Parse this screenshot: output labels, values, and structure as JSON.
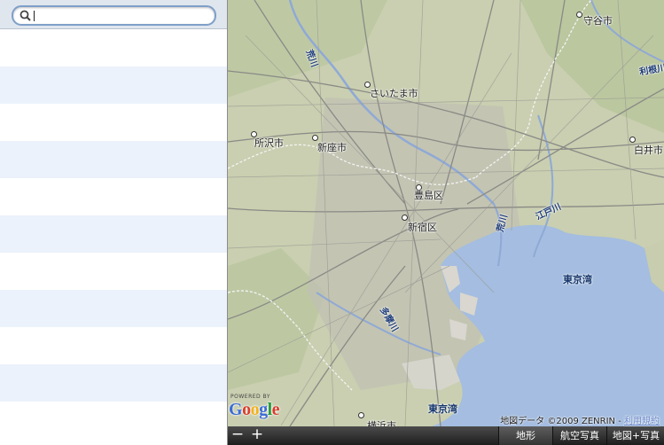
{
  "search": {
    "value": "",
    "placeholder": ""
  },
  "results": {
    "rows": 11
  },
  "map": {
    "places": {
      "moriya": "守谷市",
      "saitama": "さいたま市",
      "tokorozawa": "所沢市",
      "niiza": "新座市",
      "toshima": "豊島区",
      "shinjuku": "新宿区",
      "shiroi": "白井市",
      "yokohama": "横浜市"
    },
    "rivers": {
      "arakawa_north": "荒川",
      "arakawa_east": "荒川",
      "edogawa": "江戸川",
      "tone": "利根川",
      "tama": "多摩川"
    },
    "water": {
      "tokyo_bay_1": "東京湾",
      "tokyo_bay_2": "東京湾"
    },
    "powered_by": "POWERED BY",
    "logo": "Google",
    "attribution": "地図データ ©2009 ZENRIN - ",
    "terms": "利用規約"
  },
  "toolbar": {
    "zoom_out": "−",
    "zoom_in": "+",
    "terrain": "地形",
    "satellite": "航空写真",
    "hybrid": "地図+写真",
    "selected": "地形"
  },
  "colors": {
    "land": "#c7cdae",
    "water": "#a4bde0",
    "row_alt": "#ecf2fb",
    "search_border": "#7f9fc9"
  }
}
